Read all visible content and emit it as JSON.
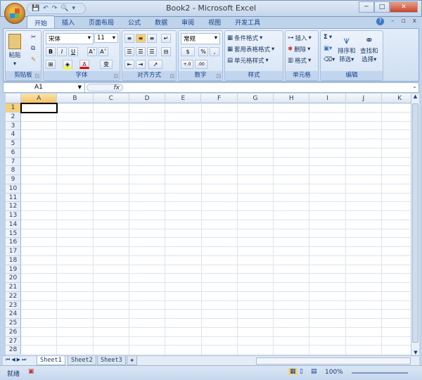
{
  "window": {
    "title": "Book2 - Microsoft Excel",
    "minimize": "─",
    "restore": "□",
    "close": "✕"
  },
  "qat": {
    "save": "💾",
    "undo": "↶",
    "redo": "↷",
    "preview": "🔍",
    "more": "▾"
  },
  "tabs": [
    {
      "label": "开始"
    },
    {
      "label": "插入"
    },
    {
      "label": "页面布局"
    },
    {
      "label": "公式"
    },
    {
      "label": "数据"
    },
    {
      "label": "审阅"
    },
    {
      "label": "视图"
    },
    {
      "label": "开发工具"
    }
  ],
  "tabright": {
    "help": "?",
    "min": "–",
    "restore": "▫",
    "close": "x"
  },
  "ribbon": {
    "clipboard": {
      "label": "剪贴板",
      "paste": "粘贴"
    },
    "font": {
      "label": "字体",
      "name": "宋体",
      "size": "11",
      "bold": "B",
      "italic": "I",
      "underline": "U",
      "grow": "A˄",
      "shrink": "A˅",
      "color": "A",
      "phonetic": "变"
    },
    "alignment": {
      "label": "对齐方式"
    },
    "number": {
      "label": "数字",
      "format": "常规",
      "percent": "%",
      "comma": ",",
      "inc": "+.0",
      "dec": ".00"
    },
    "styles": {
      "label": "样式",
      "items": [
        "条件格式",
        "套用表格格式",
        "单元格样式"
      ]
    },
    "cells": {
      "label": "单元格",
      "items": [
        "插入",
        "删除",
        "格式"
      ]
    },
    "editing": {
      "label": "编辑",
      "sum": "Σ",
      "sort": "排序和\n筛选",
      "sort1": "排序和",
      "sort2": "筛选",
      "find1": "查找和",
      "find2": "选择"
    }
  },
  "formula_bar": {
    "name_box": "A1",
    "fx": "fx",
    "value": ""
  },
  "grid": {
    "columns": [
      "A",
      "B",
      "C",
      "D",
      "E",
      "F",
      "G",
      "H",
      "I",
      "J",
      "K"
    ],
    "rows": [
      "1",
      "2",
      "3",
      "4",
      "5",
      "6",
      "7",
      "8",
      "9",
      "10",
      "11",
      "12",
      "13",
      "14",
      "15",
      "16",
      "17",
      "18",
      "19",
      "20",
      "21",
      "22",
      "23",
      "24",
      "25",
      "26",
      "27",
      "28"
    ],
    "selected": "A1"
  },
  "sheets": [
    {
      "label": "Sheet1"
    },
    {
      "label": "Sheet2"
    },
    {
      "label": "Sheet3"
    }
  ],
  "status": {
    "ready": "就绪",
    "zoom": "100%"
  }
}
